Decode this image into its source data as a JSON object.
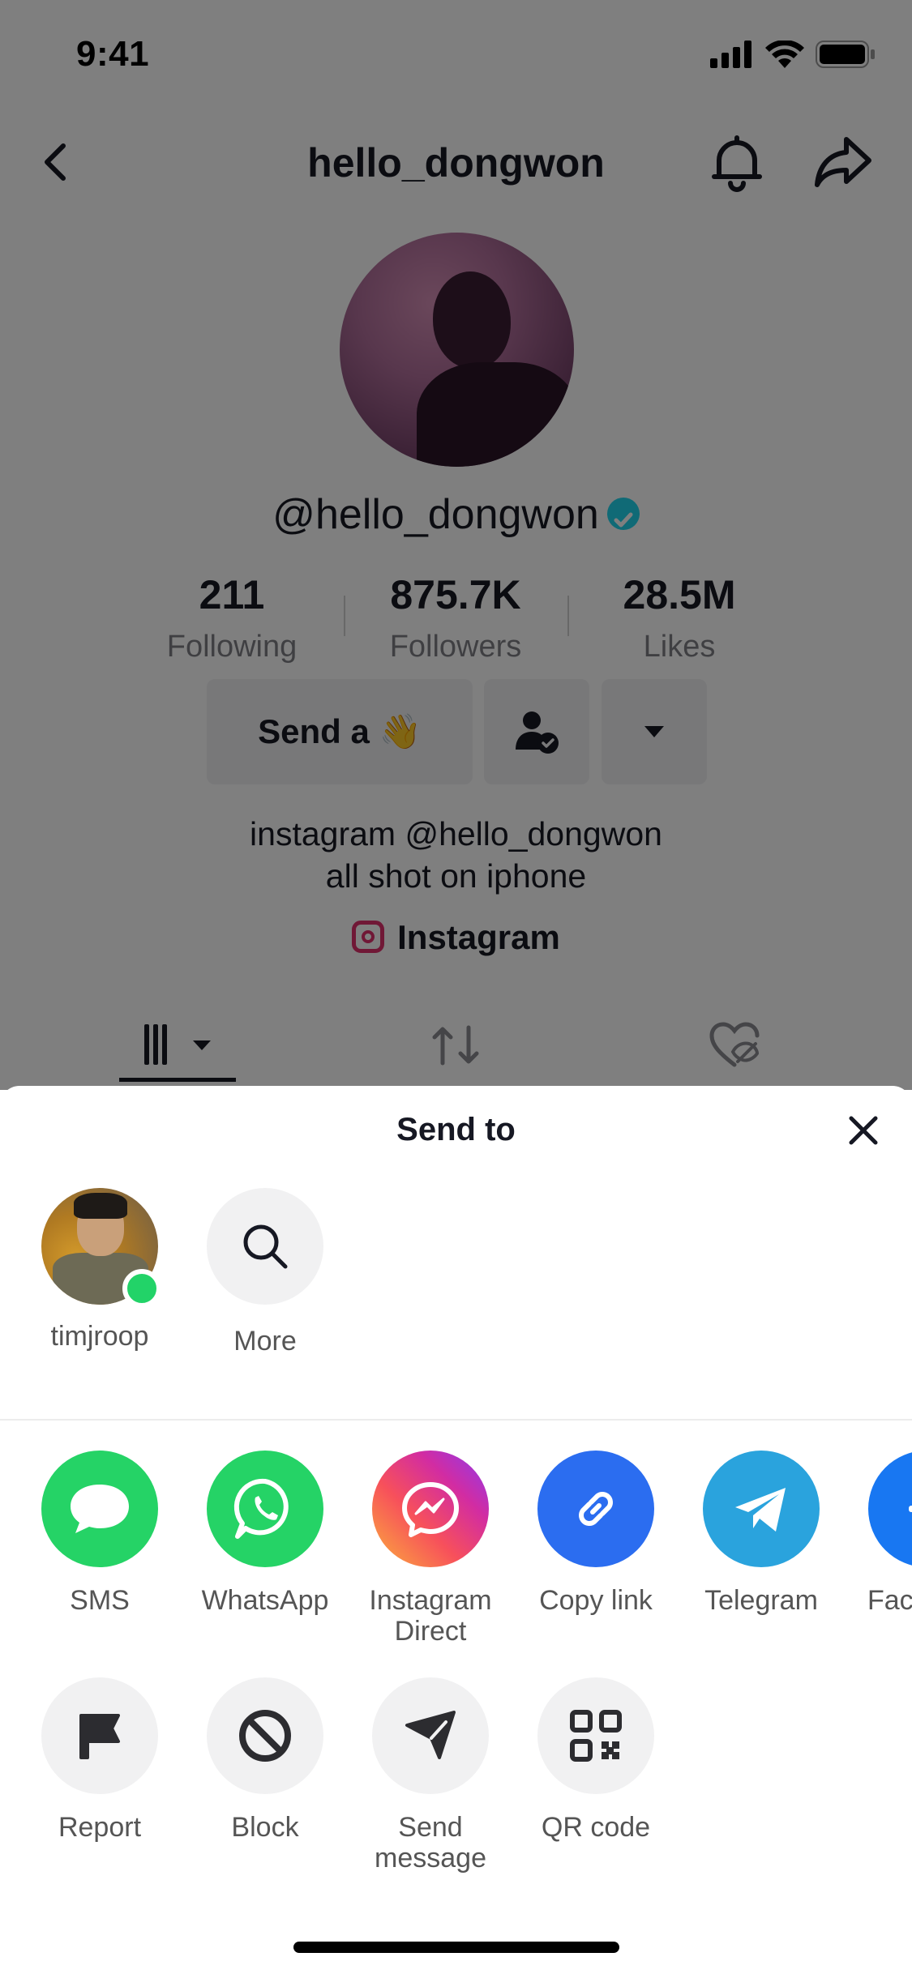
{
  "status_bar": {
    "time": "9:41"
  },
  "profile": {
    "username_title": "hello_dongwon",
    "handle": "@hello_dongwon",
    "stats": [
      {
        "value": "211",
        "label": "Following"
      },
      {
        "value": "875.7K",
        "label": "Followers"
      },
      {
        "value": "28.5M",
        "label": "Likes"
      }
    ],
    "send_button_label": "Send a 👋",
    "bio_line1": "instagram @hello_dongwon",
    "bio_line2": "all shot on iphone",
    "instagram_link_label": "Instagram"
  },
  "sheet": {
    "title": "Send to",
    "contacts": [
      {
        "label": "timjroop",
        "online": true
      },
      {
        "label": "More"
      }
    ],
    "apps": [
      {
        "label": "SMS",
        "icon": "sms-icon",
        "color": "#25d366"
      },
      {
        "label": "WhatsApp",
        "icon": "whatsapp-icon",
        "color": "#25d366"
      },
      {
        "label": "Instagram\nDirect",
        "icon": "instagram-direct-icon",
        "color": "#e1306c"
      },
      {
        "label": "Copy link",
        "icon": "link-icon",
        "color": "#2b6df0"
      },
      {
        "label": "Telegram",
        "icon": "telegram-icon",
        "color": "#2aa3dd"
      },
      {
        "label": "Face",
        "icon": "facebook-icon",
        "color": "#1877f2"
      }
    ],
    "actions": [
      {
        "label": "Report",
        "icon": "flag-icon"
      },
      {
        "label": "Block",
        "icon": "block-icon"
      },
      {
        "label": "Send\nmessage",
        "icon": "send-icon"
      },
      {
        "label": "QR code",
        "icon": "qr-code-icon"
      }
    ]
  }
}
